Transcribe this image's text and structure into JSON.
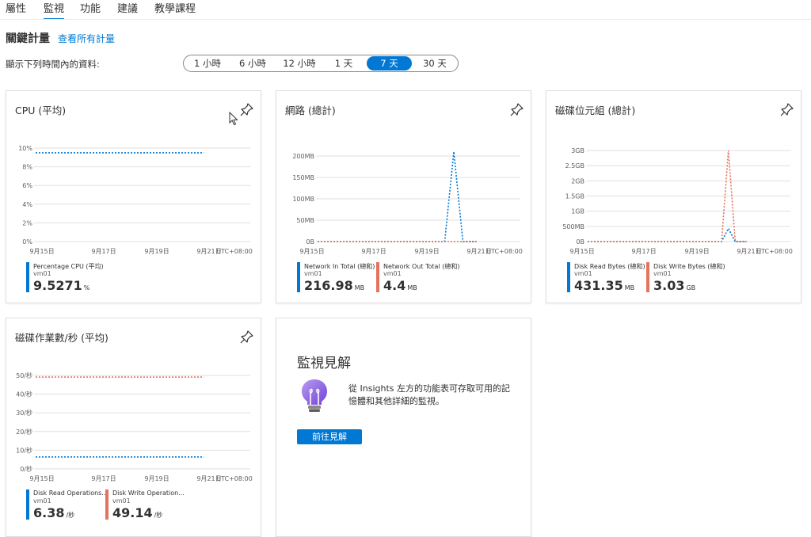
{
  "tabs": [
    "屬性",
    "監視",
    "功能",
    "建議",
    "教學課程"
  ],
  "active_tab": "監視",
  "key_metrics": {
    "title": "關鍵計量",
    "link": "查看所有計量"
  },
  "time_range": {
    "label": "顯示下列時間內的資料:",
    "options": [
      "1 小時",
      "6 小時",
      "12 小時",
      "1 天",
      "7 天",
      "30 天"
    ],
    "selected": "7 天"
  },
  "colors": {
    "accent": "#0078d4",
    "series_blue": "#0078d4",
    "series_orange": "#e3735e"
  },
  "cards": {
    "cpu": {
      "title": "CPU (平均)",
      "icon": "pin-icon",
      "legend": [
        {
          "name": "Percentage CPU (平均)",
          "resource": "vm01",
          "value": "9.5271",
          "unit": "%",
          "color": "#0078d4"
        }
      ]
    },
    "network": {
      "title": "網路 (總計)",
      "icon": "pin-icon",
      "legend": [
        {
          "name": "Network In Total (總和)",
          "resource": "vm01",
          "value": "216.98",
          "unit": "MB",
          "color": "#0078d4"
        },
        {
          "name": "Network Out Total (總和)",
          "resource": "vm01",
          "value": "4.4",
          "unit": "MB",
          "color": "#e3735e"
        }
      ]
    },
    "disk_bytes": {
      "title": "磁碟位元組 (總計)",
      "icon": "pin-icon",
      "legend": [
        {
          "name": "Disk Read Bytes (總和)",
          "resource": "vm01",
          "value": "431.35",
          "unit": "MB",
          "color": "#0078d4"
        },
        {
          "name": "Disk Write Bytes (總和)",
          "resource": "vm01",
          "value": "3.03",
          "unit": "GB",
          "color": "#e3735e"
        }
      ]
    },
    "disk_ops": {
      "title": "磁碟作業數/秒 (平均)",
      "icon": "pin-icon",
      "legend": [
        {
          "name": "Disk Read Operations...",
          "resource": "vm01",
          "value": "6.38",
          "unit": "/秒",
          "color": "#0078d4"
        },
        {
          "name": "Disk Write Operation...",
          "resource": "vm01",
          "value": "49.14",
          "unit": "/秒",
          "color": "#e3735e"
        }
      ]
    },
    "insights": {
      "title": "監視見解",
      "text": "從 Insights 左方的功能表可存取可用的記憶體和其他詳細的監視。",
      "button": "前往見解",
      "icon": "lightbulb-icon"
    }
  },
  "chart_data": [
    {
      "type": "line",
      "title": "CPU (平均)",
      "x_ticks": [
        "9月15日",
        "9月17日",
        "9月19日",
        "9月21日"
      ],
      "x_unit": "UTC+08:00",
      "y_ticks": [
        "0%",
        "2%",
        "4%",
        "6%",
        "8%",
        "10%"
      ],
      "ylim": [
        0,
        10
      ],
      "series": [
        {
          "name": "Percentage CPU (平均)",
          "color": "#0078d4",
          "x": [
            0,
            7
          ],
          "y": [
            9.5,
            9.5
          ]
        }
      ]
    },
    {
      "type": "line",
      "title": "網路 (總計)",
      "x_ticks": [
        "9月15日",
        "9月17日",
        "9月19日",
        "9月21日"
      ],
      "x_unit": "UTC+08:00",
      "y_ticks": [
        "0B",
        "50MB",
        "100MB",
        "150MB",
        "200MB"
      ],
      "ylim": [
        0,
        200
      ],
      "series": [
        {
          "name": "Network In Total (總和)",
          "color": "#0078d4",
          "x": [
            0,
            5.6,
            6.0,
            6.4,
            7.0
          ],
          "y": [
            0,
            0,
            210,
            0,
            0
          ]
        },
        {
          "name": "Network Out Total (總和)",
          "color": "#e3735e",
          "x": [
            0,
            7.0
          ],
          "y": [
            0,
            0
          ]
        }
      ]
    },
    {
      "type": "line",
      "title": "磁碟位元組 (總計)",
      "x_ticks": [
        "9月15日",
        "9月17日",
        "9月19日",
        "9月21日"
      ],
      "x_unit": "UTC+08:00",
      "y_ticks": [
        "0B",
        "500MB",
        "1GB",
        "1.5GB",
        "2GB",
        "2.5GB",
        "3GB"
      ],
      "ylim": [
        0,
        3
      ],
      "series": [
        {
          "name": "Disk Read Bytes (總和)",
          "color": "#0078d4",
          "x": [
            0,
            5.9,
            6.2,
            6.5,
            7.0
          ],
          "y": [
            0,
            0,
            0.43,
            0,
            0
          ]
        },
        {
          "name": "Disk Write Bytes (總和)",
          "color": "#e3735e",
          "x": [
            0,
            5.9,
            6.2,
            6.5,
            7.0
          ],
          "y": [
            0,
            0,
            3.0,
            0,
            0
          ]
        }
      ]
    },
    {
      "type": "line",
      "title": "磁碟作業數/秒 (平均)",
      "x_ticks": [
        "9月15日",
        "9月17日",
        "9月19日",
        "9月21日"
      ],
      "x_unit": "UTC+08:00",
      "y_ticks": [
        "0/秒",
        "10/秒",
        "20/秒",
        "30/秒",
        "40/秒",
        "50/秒"
      ],
      "ylim": [
        0,
        50
      ],
      "series": [
        {
          "name": "Disk Read Operations...",
          "color": "#0078d4",
          "x": [
            0,
            7
          ],
          "y": [
            6.4,
            6.4
          ]
        },
        {
          "name": "Disk Write Operation...",
          "color": "#e3735e",
          "x": [
            0,
            7
          ],
          "y": [
            49.1,
            49.1
          ]
        }
      ]
    }
  ]
}
